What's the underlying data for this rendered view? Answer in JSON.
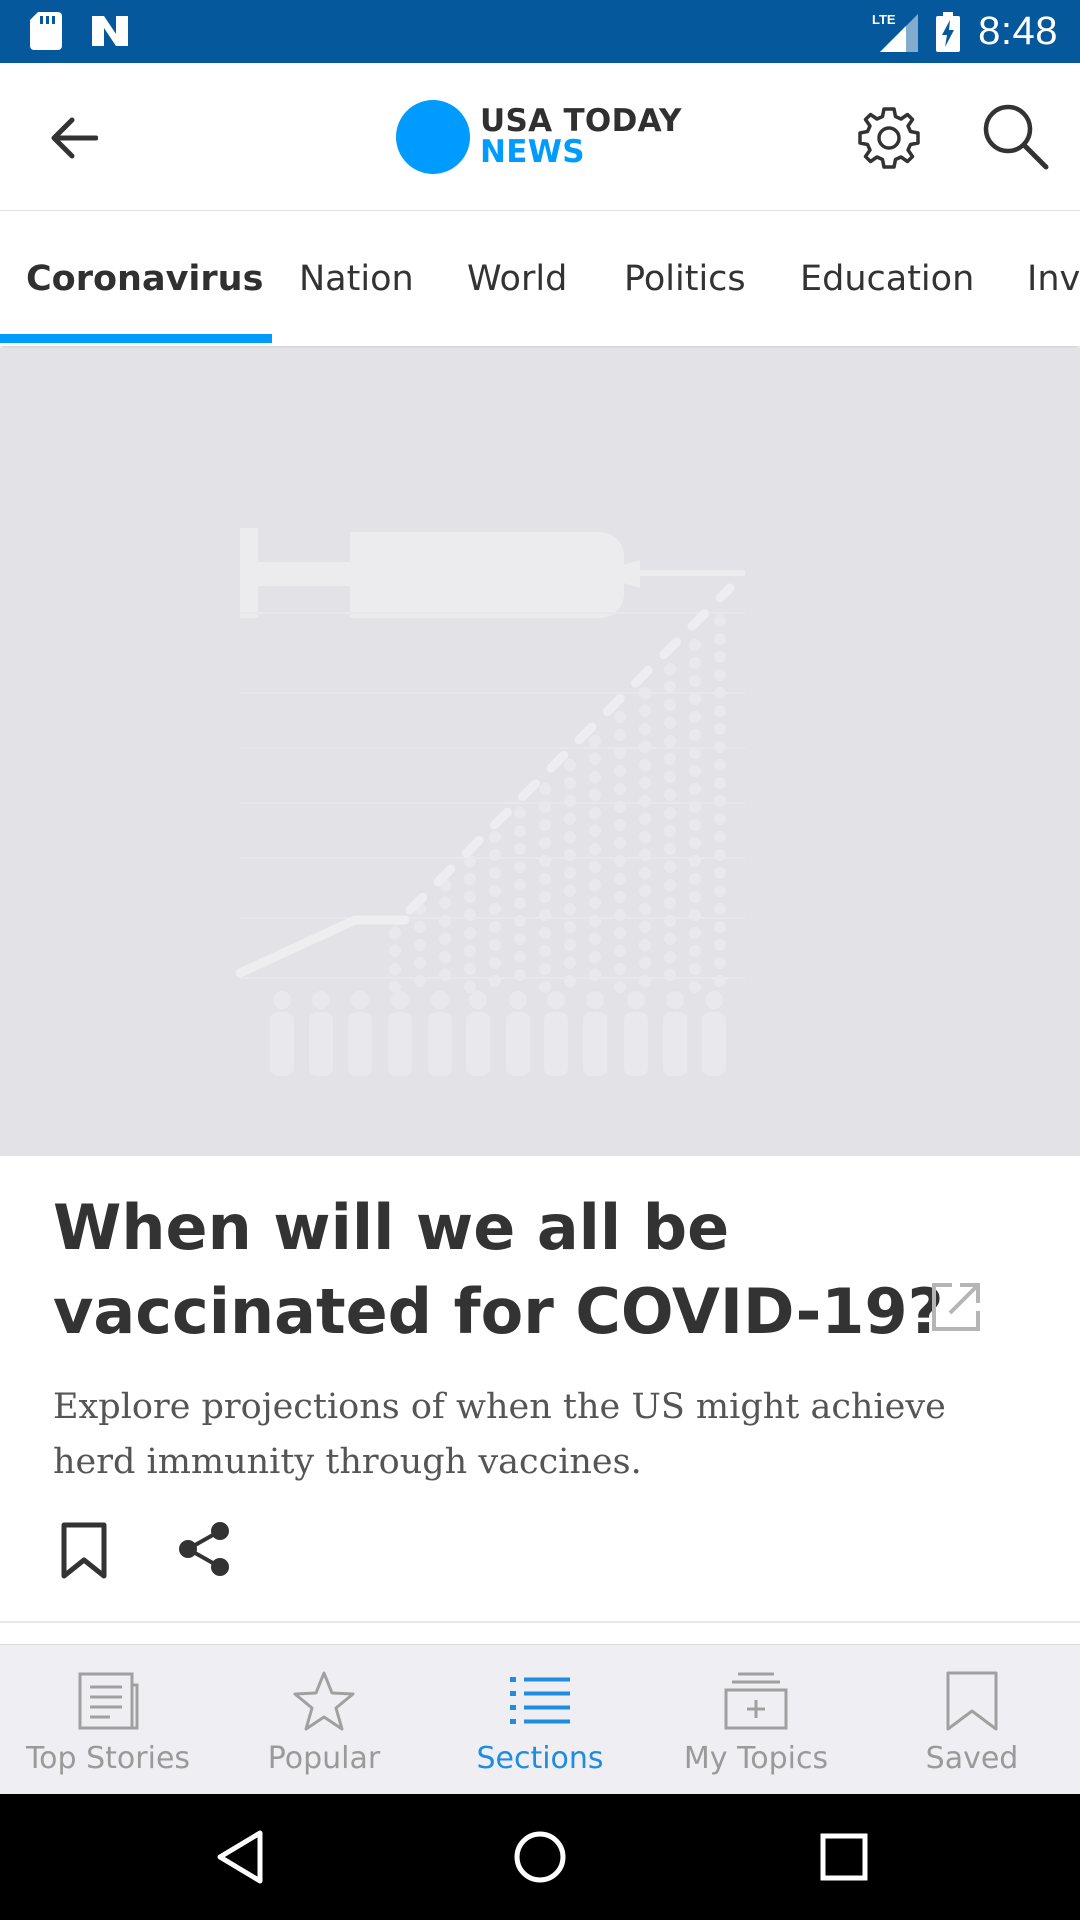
{
  "status_bar": {
    "time": "8:48",
    "network": "LTE"
  },
  "app_bar": {
    "logo_brand": "USA TODAY",
    "logo_section": "NEWS"
  },
  "tabs": [
    {
      "label": "Coronavirus",
      "active": true
    },
    {
      "label": "Nation"
    },
    {
      "label": "World"
    },
    {
      "label": "Politics"
    },
    {
      "label": "Education"
    },
    {
      "label": "Inv"
    }
  ],
  "article": {
    "headline": "When will we all be vaccinated for COVID-19?",
    "summary": "Explore projections of when the US might achieve herd immunity through vaccines."
  },
  "bottom_nav": [
    {
      "label": "Top Stories",
      "icon": "newspaper-icon"
    },
    {
      "label": "Popular",
      "icon": "star-icon"
    },
    {
      "label": "Sections",
      "icon": "list-icon",
      "active": true
    },
    {
      "label": "My Topics",
      "icon": "topics-icon"
    },
    {
      "label": "Saved",
      "icon": "bookmark-icon"
    }
  ],
  "colors": {
    "status_bar": "#04589b",
    "accent": "#009bff",
    "hero_bg": "#e3e3e7",
    "nav_active": "#1e8ddf"
  }
}
